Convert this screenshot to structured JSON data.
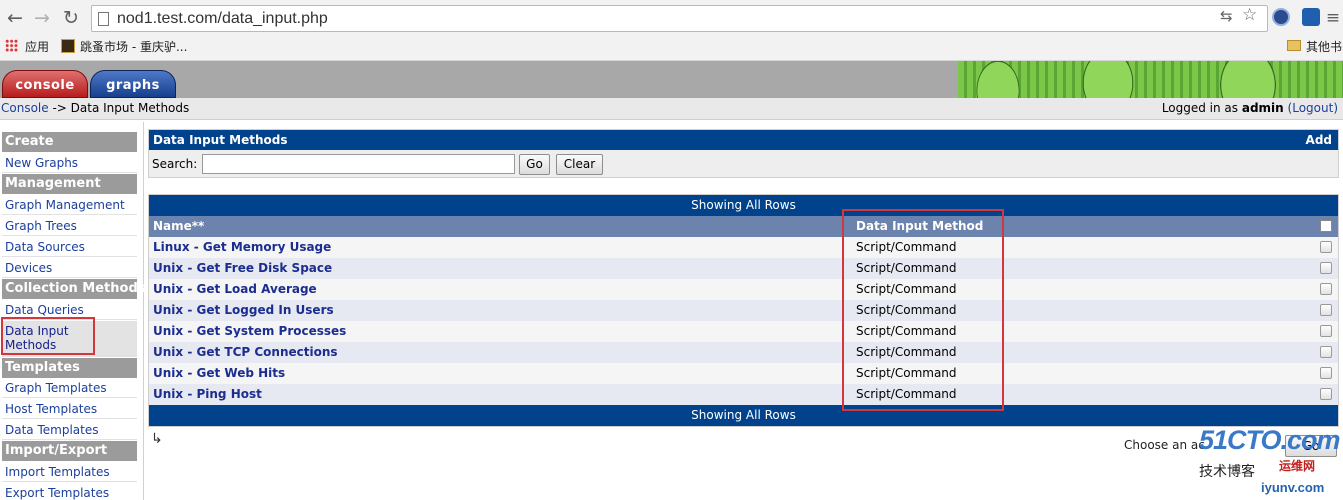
{
  "browser": {
    "url": "nod1.test.com/data_input.php",
    "bookmarks": {
      "apps": "应用",
      "item1": "跳蚤市场 - 重庆驴...",
      "other": "其他书"
    }
  },
  "tabs": {
    "console": "console",
    "graphs": "graphs"
  },
  "breadcrumb": {
    "root": "Console",
    "sep": " -> ",
    "current": "Data Input Methods"
  },
  "login": {
    "prefix": "Logged in as ",
    "user": "admin",
    "logout": "(Logout)"
  },
  "sidebar": {
    "create": "Create",
    "new_graphs": "New Graphs",
    "management": "Management",
    "graph_management": "Graph Management",
    "graph_trees": "Graph Trees",
    "data_sources": "Data Sources",
    "devices": "Devices",
    "collection_methods": "Collection Methods",
    "data_queries": "Data Queries",
    "data_input_methods_1": "Data Input",
    "data_input_methods_2": "Methods",
    "templates": "Templates",
    "graph_templates": "Graph Templates",
    "host_templates": "Host Templates",
    "data_templates": "Data Templates",
    "import_export": "Import/Export",
    "import_templates": "Import Templates",
    "export_templates": "Export Templates"
  },
  "filter": {
    "title": "Data Input Methods",
    "add": "Add",
    "search_label": "Search:",
    "search_value": "",
    "go": "Go",
    "clear": "Clear"
  },
  "table": {
    "showing": "Showing All Rows",
    "col_name": "Name**",
    "col_method": "Data Input Method",
    "rows": [
      {
        "name": "Linux - Get Memory Usage",
        "method": "Script/Command"
      },
      {
        "name": "Unix - Get Free Disk Space",
        "method": "Script/Command"
      },
      {
        "name": "Unix - Get Load Average",
        "method": "Script/Command"
      },
      {
        "name": "Unix - Get Logged In Users",
        "method": "Script/Command"
      },
      {
        "name": "Unix - Get System Processes",
        "method": "Script/Command"
      },
      {
        "name": "Unix - Get TCP Connections",
        "method": "Script/Command"
      },
      {
        "name": "Unix - Get Web Hits",
        "method": "Script/Command"
      },
      {
        "name": "Unix - Ping Host",
        "method": "Script/Command"
      }
    ]
  },
  "action": {
    "choose": "Choose an ac",
    "go": "Go"
  },
  "watermark": {
    "brand": "51CTO.com",
    "text": "技术博客",
    "red": "运维网",
    "site": "iyunv.com"
  },
  "colors": {
    "header_blue": "#00438c",
    "column_header": "#6b83ad",
    "highlight_red": "#d1373d",
    "link": "#1b3f9c"
  }
}
